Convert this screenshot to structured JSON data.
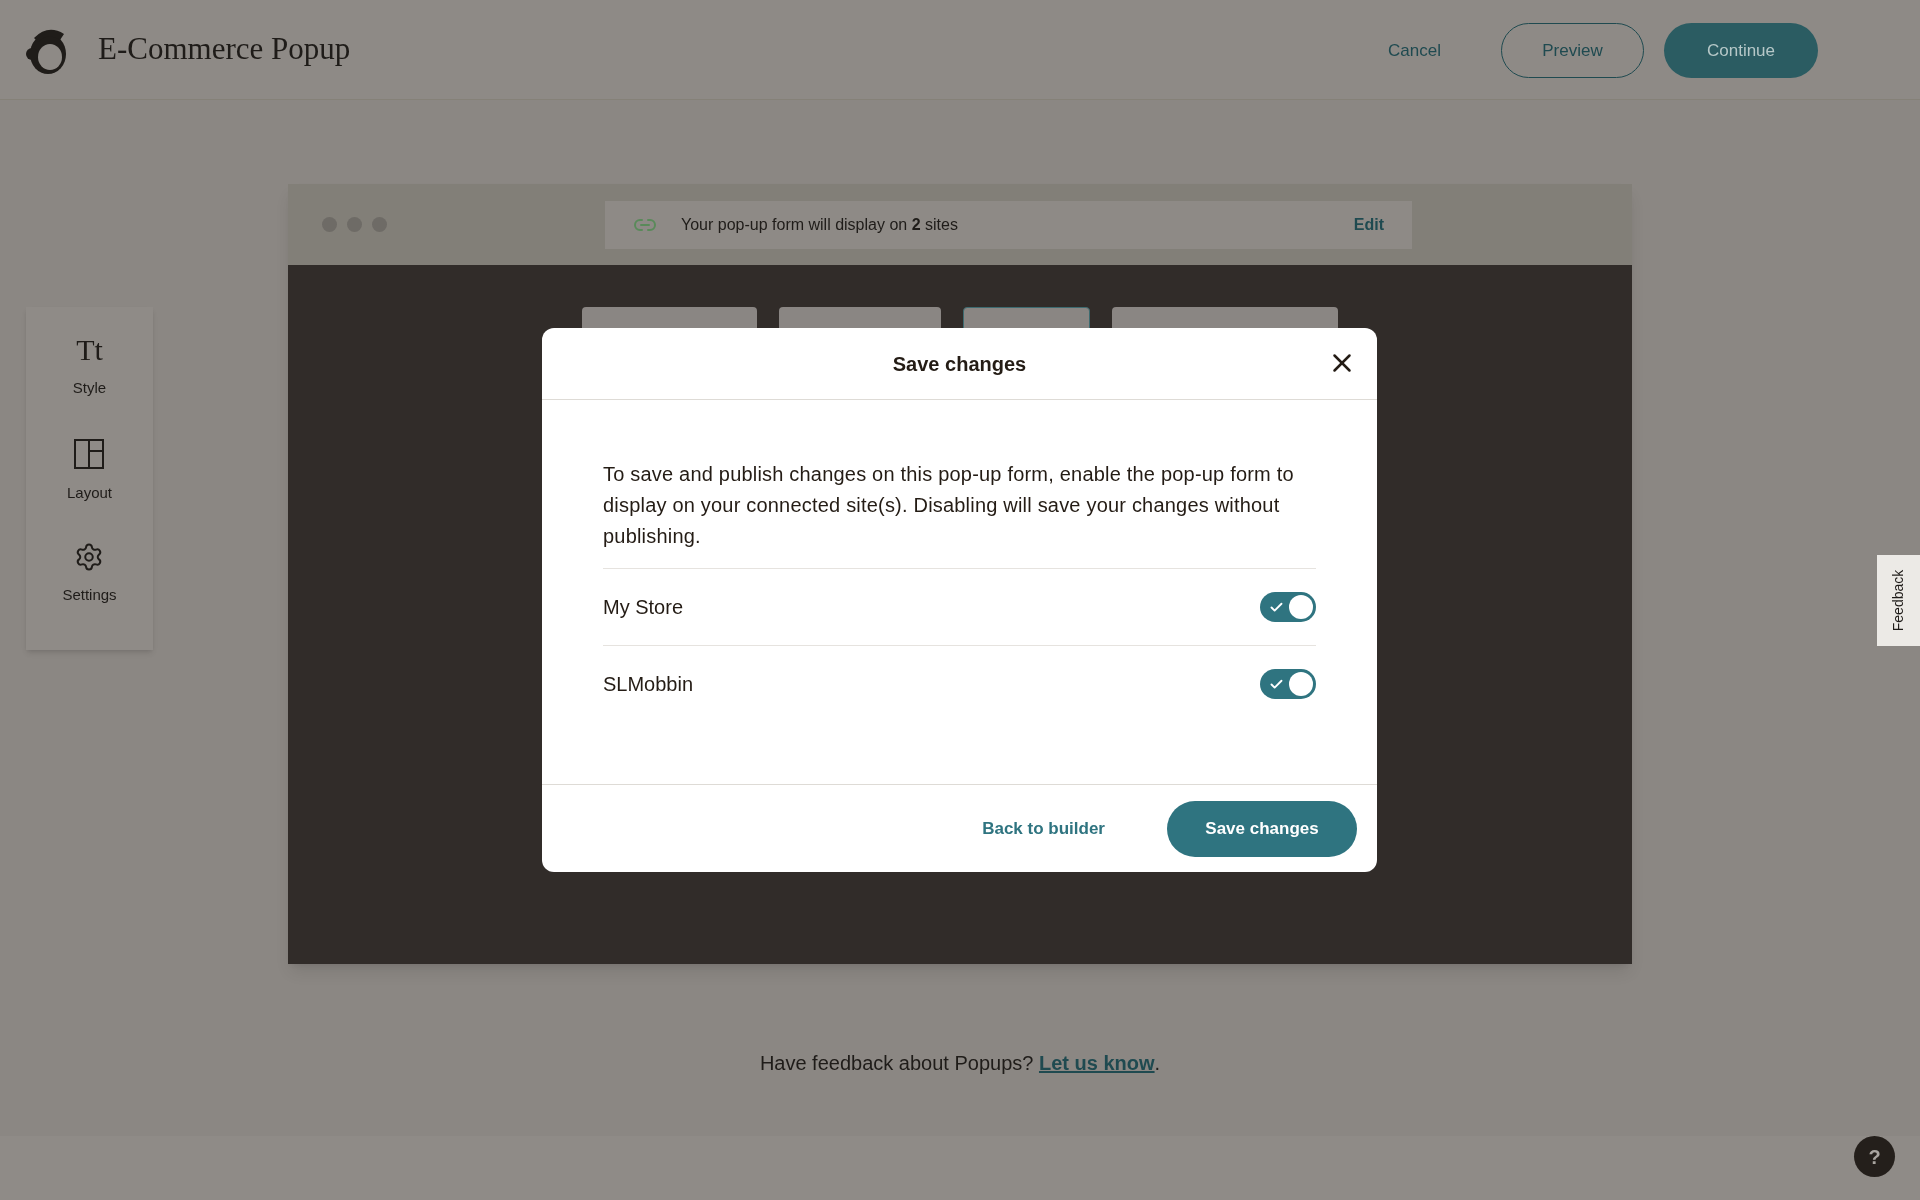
{
  "header": {
    "title": "E-Commerce Popup",
    "cancel": "Cancel",
    "preview": "Preview",
    "continue": "Continue"
  },
  "sidebar": {
    "items": [
      {
        "kind": "style",
        "label": "Style",
        "glyph": "Tt"
      },
      {
        "kind": "layout",
        "label": "Layout"
      },
      {
        "kind": "settings",
        "label": "Settings"
      }
    ]
  },
  "browser": {
    "notice": "Your pop-up form will display on **2** sites",
    "edit": "Edit"
  },
  "modal": {
    "title": "Save changes",
    "body": "To save and publish changes on this pop-up form, enable the pop-up form to display on your connected site(s). Disabling will save your changes without publishing.",
    "sites": [
      {
        "name": "My Store",
        "on": true
      },
      {
        "name": "SLMobbin",
        "on": true
      }
    ],
    "back": "Back to builder",
    "save": "Save changes"
  },
  "feedback_tab": "Feedback",
  "footer": {
    "text": "Have feedback about Popups?",
    "link": "Let us know",
    "after": "."
  },
  "help": "?"
}
